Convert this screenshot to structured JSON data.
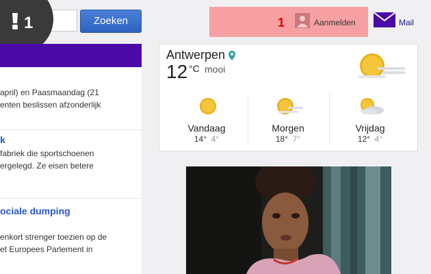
{
  "search": {
    "button_label": "Zoeken",
    "input_value": ""
  },
  "notifications": {
    "count": "1"
  },
  "login": {
    "count": "1",
    "label": "Aanmelden"
  },
  "mail": {
    "label": "Mail"
  },
  "news": {
    "items": [
      {
        "title": "",
        "lines": [
          "april) en Paasmaandag (21",
          "enten beslissen afzonderlijk"
        ]
      },
      {
        "title": "k",
        "lines": [
          "fabriek die sportschoenen",
          "ergelegd. Ze eisen betere"
        ]
      },
      {
        "title": "ociale dumping",
        "lines": [
          "enkort strenger toezien op de",
          "et Europees Parlement in"
        ]
      }
    ]
  },
  "weather": {
    "city": "Antwerpen",
    "current_temp": "12",
    "unit": "°C",
    "condition": "mooi",
    "forecast": [
      {
        "day": "Vandaag",
        "high": "14°",
        "low": "4°",
        "icon": "sun-icon"
      },
      {
        "day": "Morgen",
        "high": "18°",
        "low": "7°",
        "icon": "sun-haze-icon"
      },
      {
        "day": "Vrijdag",
        "high": "12°",
        "low": "4°",
        "icon": "sun-cloud-icon"
      }
    ]
  },
  "colors": {
    "accent_blue": "#3366cc",
    "news_bar_purple": "#4b0aa8",
    "login_highlight": "#f6a0a3",
    "sun_yellow": "#f2b71e"
  }
}
